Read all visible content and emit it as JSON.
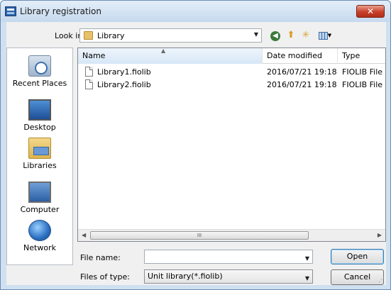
{
  "window": {
    "title": "Library registration",
    "close_glyph": "✕"
  },
  "toolbar": {
    "look_in_label": "Look in:",
    "look_in_value": "Library",
    "icons": [
      "back-icon",
      "up-folder-icon",
      "new-folder-icon",
      "view-menu-icon"
    ]
  },
  "places": [
    {
      "label": "Recent Places",
      "icon": "recent-places-icon"
    },
    {
      "label": "Desktop",
      "icon": "desktop-icon"
    },
    {
      "label": "Libraries",
      "icon": "libraries-icon"
    },
    {
      "label": "Computer",
      "icon": "computer-icon"
    },
    {
      "label": "Network",
      "icon": "network-icon"
    }
  ],
  "file_list": {
    "columns": [
      "Name",
      "Date modified",
      "Type"
    ],
    "rows": [
      {
        "name": "Library1.fiolib",
        "date": "2016/07/21 19:18",
        "type": "FIOLIB File"
      },
      {
        "name": "Library2.fiolib",
        "date": "2016/07/21 19:18",
        "type": "FIOLIB File"
      }
    ],
    "scroll_thumb_glyph": "III"
  },
  "form": {
    "file_name_label": "File name:",
    "file_name_value": "",
    "files_of_type_label": "Files of type:",
    "files_of_type_value": "Unit library(*.fiolib)"
  },
  "buttons": {
    "open": "Open",
    "cancel": "Cancel"
  }
}
